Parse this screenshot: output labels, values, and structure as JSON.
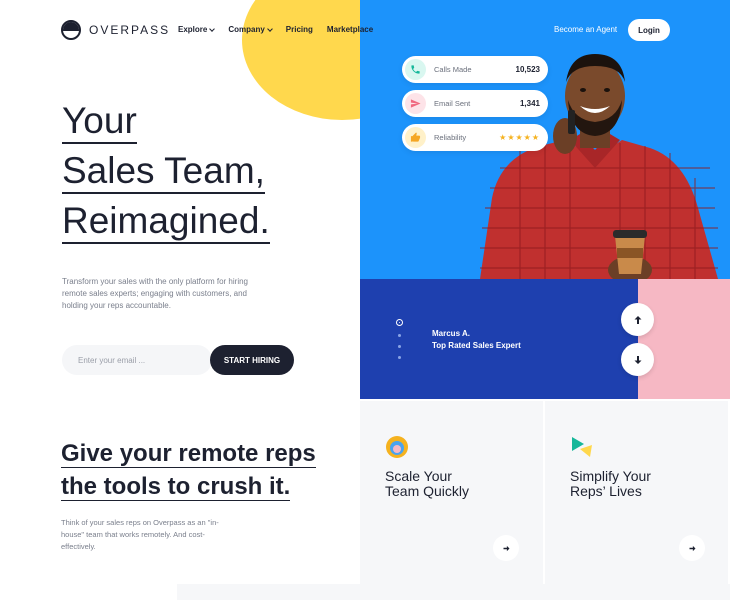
{
  "brand": {
    "name": "OVERPASS"
  },
  "nav": {
    "items": [
      {
        "label": "Explore",
        "has_dropdown": true
      },
      {
        "label": "Company",
        "has_dropdown": true
      },
      {
        "label": "Pricing",
        "has_dropdown": false
      },
      {
        "label": "Marketplace",
        "has_dropdown": false
      }
    ],
    "agent_link": "Become an Agent",
    "login": "Login"
  },
  "hero": {
    "title_lines": [
      "Your",
      "Sales Team,",
      "Reimagined."
    ],
    "description": "Transform your sales with the only platform for hiring remote sales experts; engaging with customers, and holding your reps accountable.",
    "email_placeholder": "Enter your email ...",
    "cta": "START HIRING"
  },
  "stats": [
    {
      "label": "Calls Made",
      "value": "10,523",
      "icon": "phone-icon",
      "icon_bg": "#d9f7f0",
      "icon_color": "#16b79a"
    },
    {
      "label": "Email Sent",
      "value": "1,341",
      "icon": "paper-plane-icon",
      "icon_bg": "#fde3e8",
      "icon_color": "#f0687f"
    },
    {
      "label": "Reliability",
      "value": "★★★★★",
      "rating": 5,
      "icon": "thumbs-up-icon",
      "icon_bg": "#fff1c9",
      "icon_color": "#f5a623"
    }
  ],
  "testimonial": {
    "name": "Marcus A.",
    "role": "Top Rated Sales Expert",
    "slides": 4,
    "active_slide": 1
  },
  "section": {
    "title_lines": [
      "Give your remote reps",
      "the tools to crush it."
    ],
    "description": "Think of your sales reps on Overpass as an \"in-house\" team that works remotely. And cost-effectively."
  },
  "features": [
    {
      "title_lines": [
        "Scale Your",
        "Team Quickly"
      ],
      "icon": "circles-icon"
    },
    {
      "title_lines": [
        "Simplify Your",
        "Reps’ Lives"
      ],
      "icon": "triangles-icon"
    }
  ],
  "colors": {
    "accent_blue": "#1c93fb",
    "band_blue": "#1e40af",
    "yellow": "#ffd84d",
    "pink": "#f6b8c4",
    "dark": "#1d2130"
  }
}
